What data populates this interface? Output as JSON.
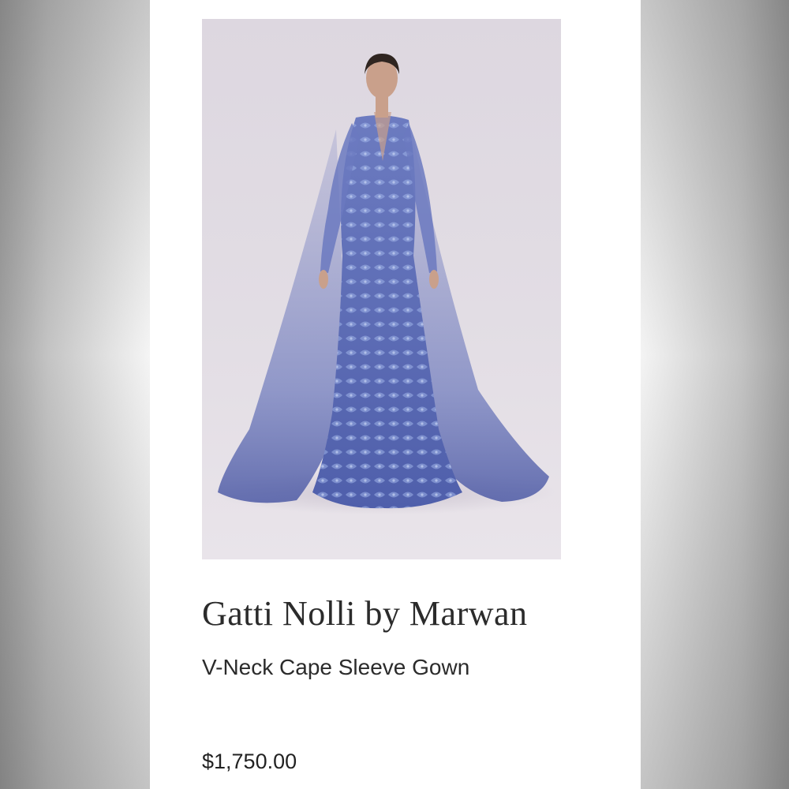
{
  "product": {
    "brand": "Gatti Nolli by Marwan",
    "name": "V-Neck Cape Sleeve Gown",
    "price": "$1,750.00",
    "image_icon": "product-photo"
  },
  "colors": {
    "background": "#f3f3f3",
    "card": "#ffffff",
    "text": "#2b2b2b",
    "gown": "#5f6fb3"
  }
}
